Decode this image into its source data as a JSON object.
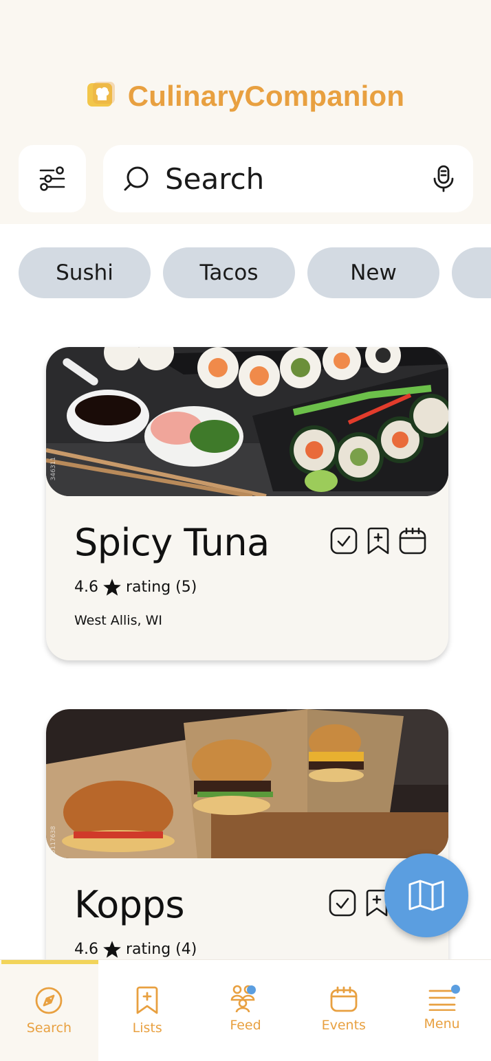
{
  "app": {
    "name": "CulinaryCompanion"
  },
  "search": {
    "placeholder": "Search"
  },
  "chips": [
    "Sushi",
    "Tacos",
    "New",
    ""
  ],
  "restaurants": [
    {
      "name": "Spicy Tuna",
      "rating": "4.6",
      "rating_label": "rating (5)",
      "location": "West Allis, WI",
      "image_watermark": "346311"
    },
    {
      "name": "Kopps",
      "rating": "4.6",
      "rating_label": "rating (4)",
      "image_watermark": "5117638"
    }
  ],
  "nav": [
    {
      "label": "Search",
      "icon": "compass-icon",
      "active": true
    },
    {
      "label": "Lists",
      "icon": "bookmark-plus-icon",
      "active": false
    },
    {
      "label": "Feed",
      "icon": "people-icon",
      "active": false,
      "badge": true
    },
    {
      "label": "Events",
      "icon": "calendar-icon",
      "active": false
    },
    {
      "label": "Menu",
      "icon": "hamburger-icon",
      "active": false,
      "badge": true
    }
  ],
  "colors": {
    "brand": "#e8a040",
    "accent_blue": "#5b9ee0",
    "chip": "#d3dae2",
    "header_bg": "#faf7f1",
    "active_bar": "#f2d45a"
  }
}
